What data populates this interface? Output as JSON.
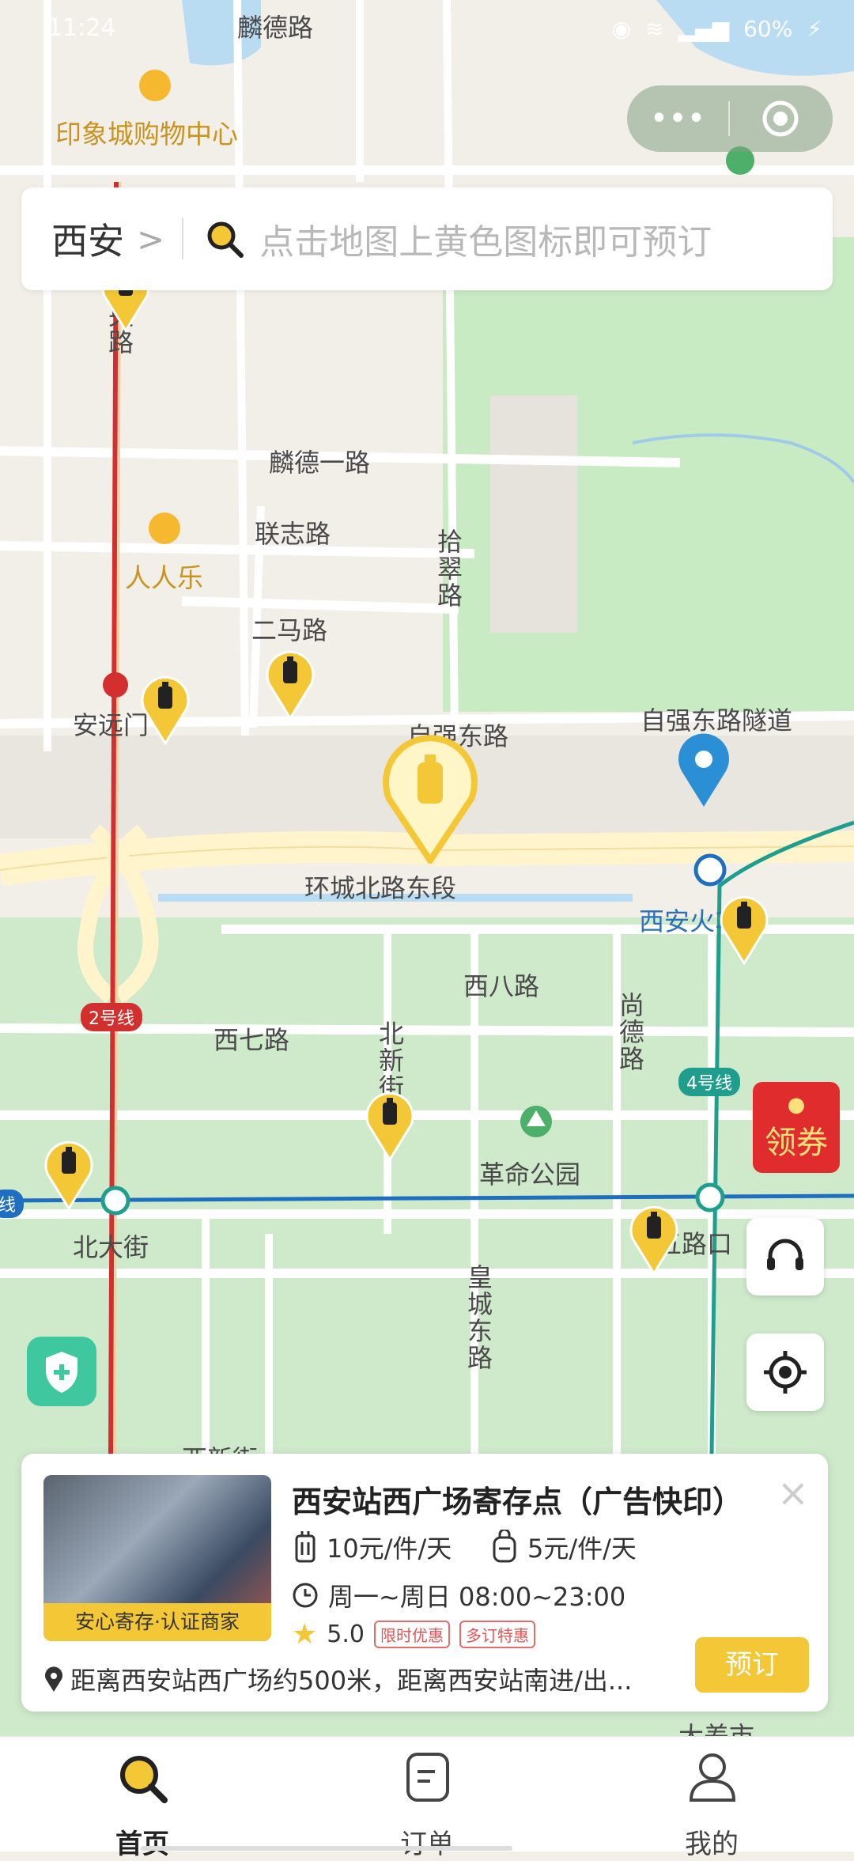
{
  "status": {
    "time": "11:24",
    "battery": "60%"
  },
  "capsule": {
    "more_icon": "more-dots-icon",
    "close_icon": "target-close-icon"
  },
  "search": {
    "city": "西安",
    "arrow": ">",
    "placeholder": "点击地图上黄色图标即可预订"
  },
  "map": {
    "labels": [
      {
        "name": "street-linde-rd",
        "text": "麟德路"
      },
      {
        "name": "poi-yinxiang-mall",
        "text": "印象城购物中心"
      },
      {
        "name": "street-linde-1",
        "text": "麟德一路"
      },
      {
        "name": "street-lianzhi",
        "text": "联志路"
      },
      {
        "name": "poi-renrenle",
        "text": "人人乐"
      },
      {
        "name": "street-erma",
        "text": "二马路"
      },
      {
        "name": "street-anyuanmen",
        "text": "安远门"
      },
      {
        "name": "street-ziqiang-east",
        "text": "自强东路"
      },
      {
        "name": "street-ziqiang-tunnel",
        "text": "自强东路隧道"
      },
      {
        "name": "street-huancheng-north-east",
        "text": "环城北路东段"
      },
      {
        "name": "station-xian",
        "text": "西安火车站"
      },
      {
        "name": "street-xiba",
        "text": "西八路"
      },
      {
        "name": "street-xiqi",
        "text": "西七路"
      },
      {
        "name": "street-beidajie",
        "text": "北大街"
      },
      {
        "name": "poi-geming-park",
        "text": "革命公园"
      },
      {
        "name": "street-wulukou",
        "text": "五路口"
      },
      {
        "name": "street-xixinjie",
        "text": "西新街"
      },
      {
        "name": "street-dachaishi",
        "text": "大差市"
      }
    ],
    "vertical_labels": [
      {
        "name": "street-zhongyang",
        "text": "央路"
      },
      {
        "name": "street-shicui",
        "text": "拾翠路"
      },
      {
        "name": "street-beixinjie",
        "text": "北新街"
      },
      {
        "name": "street-shangde",
        "text": "尚德路"
      },
      {
        "name": "street-huangcheng-east",
        "text": "皇城东路"
      }
    ],
    "metro_lines": [
      {
        "name": "line-2-badge",
        "text": "2号线",
        "color": "#d32f2f"
      },
      {
        "name": "line-4-badge",
        "text": "4号线",
        "color": "#1f9e8e"
      },
      {
        "name": "line-1-badge",
        "text": "线",
        "color": "#1f6fc0"
      }
    ],
    "colors": {
      "park": "#c9ebc4",
      "road": "#ffffff",
      "ring_road": "#fff4cc",
      "water": "#b9dcf3",
      "pin": "#f3c735",
      "metro2": "#d32f2f",
      "metro4": "#1f9e8e",
      "metro1": "#1f6fc0"
    }
  },
  "promo": {
    "label": "领券"
  },
  "controls": {
    "service_icon": "headset-icon",
    "locate_icon": "locate-icon",
    "shield_icon": "shield-plus-icon"
  },
  "card": {
    "title": "西安站西广场寄存点（广告快印）",
    "badge": "安心寄存·认证商家",
    "luggage_price": "10元/件/天",
    "bag_price": "5元/件/天",
    "hours": "周一~周日 08:00~23:00",
    "rating": "5.0",
    "tags": [
      "限时优惠",
      "多订特惠"
    ],
    "address": "距离西安站西广场约500米，距离西安站南进/出...",
    "book": "预订",
    "close": "×"
  },
  "tabbar": {
    "tabs": [
      {
        "label": "首页",
        "icon": "search-icon",
        "active": true
      },
      {
        "label": "订单",
        "icon": "order-icon",
        "active": false
      },
      {
        "label": "我的",
        "icon": "user-icon",
        "active": false
      }
    ]
  }
}
